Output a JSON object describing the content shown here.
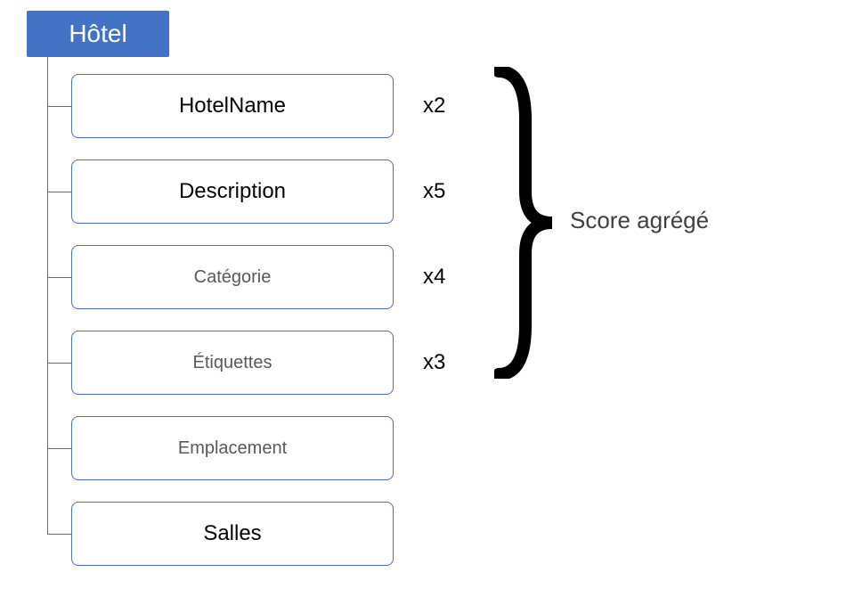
{
  "root": {
    "label": "Hôtel"
  },
  "fields": [
    {
      "label": "HotelName",
      "weight": "x2",
      "style": "bold"
    },
    {
      "label": "Description",
      "weight": "x5",
      "style": "bold"
    },
    {
      "label": "Catégorie",
      "weight": "x4",
      "style": "small"
    },
    {
      "label": "Étiquettes",
      "weight": "x3",
      "style": "small"
    },
    {
      "label": "Emplacement",
      "weight": "",
      "style": "small"
    },
    {
      "label": "Salles",
      "weight": "",
      "style": "bold"
    }
  ],
  "aggregate": {
    "label": "Score agrégé"
  },
  "colors": {
    "primary": "#4472C4",
    "text_dark": "#000000",
    "text_muted": "#595959"
  }
}
